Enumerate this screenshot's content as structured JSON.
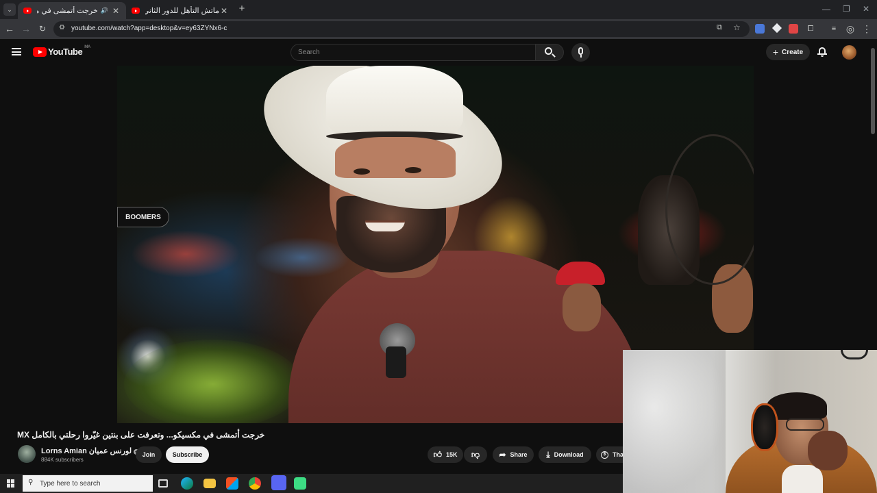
{
  "browser": {
    "tabs": [
      {
        "title": "خرجت أتمشى في مكسيكو... وتعرفت على بنتين غيّروا رحلتي بالكامل MX"
      },
      {
        "title": "ماتش التأهل للدور الثاني؟ التشكيلة"
      }
    ],
    "new_tab_label": "+",
    "url": "youtube.com/watch?app=desktop&v=ey63ZYNx6-c"
  },
  "youtube": {
    "logo_text": "YouTube",
    "country_code": "MA",
    "search_placeholder": "Search",
    "create_label": "Create"
  },
  "video": {
    "title": "خرجت أتمشى في مكسيكو... وتعرفت على بنتين غيّروا رحلتي بالكامل MX",
    "sign_text": "BOOMERS"
  },
  "channel": {
    "name": "Lorns Amian لورنس عميان",
    "subscribers": "884K subscribers",
    "join_label": "Join",
    "subscribe_label": "Subscribe"
  },
  "actions": {
    "likes": "15K",
    "share_label": "Share",
    "download_label": "Download",
    "thanks_label": "Tha"
  },
  "taskbar": {
    "search_placeholder": "Type here to search"
  },
  "colors": {
    "youtube_red": "#ff0000",
    "background": "#0f0f0f",
    "pill": "#272727"
  }
}
